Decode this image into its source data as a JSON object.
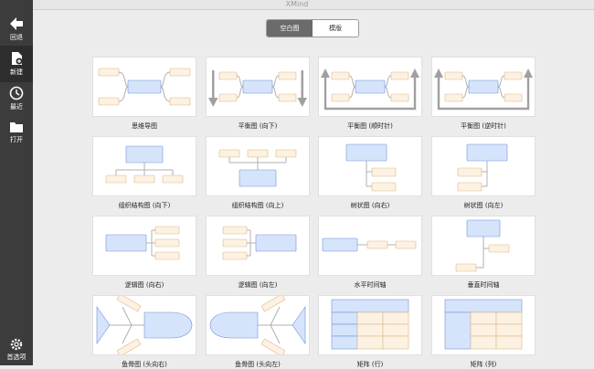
{
  "window": {
    "title": "XMind"
  },
  "colors": {
    "accent_fill": "#d6e4fb",
    "accent_stroke": "#6f93d5",
    "topic_fill": "#fdf1e1",
    "topic_stroke": "#d9b98e",
    "sidebar": "#3c3c3c"
  },
  "sidebar": {
    "back_label": "回退",
    "new_label": "新建",
    "recent_label": "最近",
    "open_label": "打开",
    "prefs_label": "首选项"
  },
  "tabs": {
    "blank": "空白图",
    "template": "模版"
  },
  "templates": [
    {
      "label": "思维导图",
      "icon": "mindmap-icon"
    },
    {
      "label": "平衡图 (向下)",
      "icon": "balance-down-icon"
    },
    {
      "label": "平衡图 (顺时针)",
      "icon": "balance-clockwise-icon"
    },
    {
      "label": "平衡图 (逆时针)",
      "icon": "balance-counterclockwise-icon"
    },
    {
      "label": "组织结构图 (向下)",
      "icon": "org-chart-down-icon"
    },
    {
      "label": "组织结构图 (向上)",
      "icon": "org-chart-up-icon"
    },
    {
      "label": "树状图 (向右)",
      "icon": "tree-right-icon"
    },
    {
      "label": "树状图 (向左)",
      "icon": "tree-left-icon"
    },
    {
      "label": "逻辑图 (向右)",
      "icon": "logic-right-icon"
    },
    {
      "label": "逻辑图 (向左)",
      "icon": "logic-left-icon"
    },
    {
      "label": "水平时间轴",
      "icon": "timeline-horizontal-icon"
    },
    {
      "label": "垂直时间轴",
      "icon": "timeline-vertical-icon"
    },
    {
      "label": "鱼骨图 (头向右)",
      "icon": "fishbone-right-icon"
    },
    {
      "label": "鱼骨图 (头向左)",
      "icon": "fishbone-left-icon"
    },
    {
      "label": "矩阵 (行)",
      "icon": "matrix-row-icon"
    },
    {
      "label": "矩阵 (列)",
      "icon": "matrix-column-icon"
    }
  ]
}
